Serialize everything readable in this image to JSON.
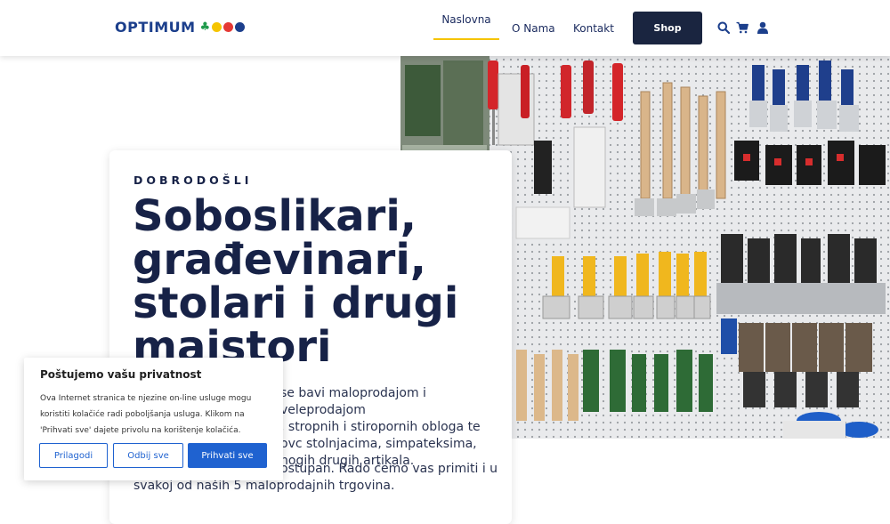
{
  "header": {
    "logo_text": "OPTIMUM",
    "logo_colors": [
      "#1f9a4b",
      "#f5c400",
      "#e53935",
      "#1c3f8c"
    ],
    "nav": [
      "Naslovna",
      "O Nama",
      "Kontakt"
    ],
    "shop_label": "Shop",
    "accent": "#f5c400",
    "icons": [
      "search-icon",
      "cart-icon",
      "user-icon"
    ]
  },
  "hero": {
    "eyebrow": "DOBRODOŠLI",
    "title": "Soboslikari, građevinari, stolari i drugi majstori",
    "para1_lines": [
      "se bavi maloprodajom i veleprodajom",
      ", stropnih i stiropornih obloga te",
      "ovc stolnjacima, simpateksima,",
      "nogih drugih artikala."
    ],
    "para2_lines": [
      "ostupan. Rado ćemo vas primiti i u",
      "svakoj od naših 5 maloprodajnih trgovina."
    ]
  },
  "cookie": {
    "title": "Poštujemo vašu privatnost",
    "text": "Ova Internet stranica te njezine on-line usluge mogu koristiti kolačiće radi poboljšanja usluga. Klikom na 'Prihvati sve' dajete privolu na korištenje kolačića.",
    "customize_label": "Prilagodi",
    "reject_label": "Odbij sve",
    "accept_label": "Prihvati sve",
    "button_color": "#1f62d0"
  }
}
